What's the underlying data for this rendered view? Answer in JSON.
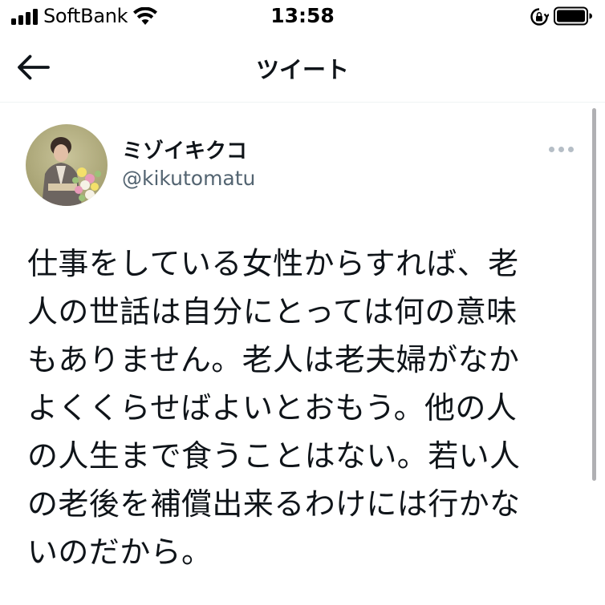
{
  "status_bar": {
    "carrier": "SoftBank",
    "time": "13:58"
  },
  "header": {
    "title": "ツイート",
    "back_icon": "arrow-left-icon"
  },
  "tweet": {
    "display_name": "ミゾイキクコ",
    "handle": "@kikutomatu",
    "text": "仕事をしている女性からすれば、老\n人の世話は自分にとっては何の意味\nもありません。老人は老夫婦がなか\nよくくらせばよいとおもう。他の人\nの人生まで食うことはない。若い人\nの老後を補償出来るわけには行かな\nいのだから。",
    "more_icon": "more-horizontal-icon"
  },
  "colors": {
    "text_primary": "#0f1419",
    "text_secondary": "#536471",
    "divider": "#eff3f4"
  }
}
